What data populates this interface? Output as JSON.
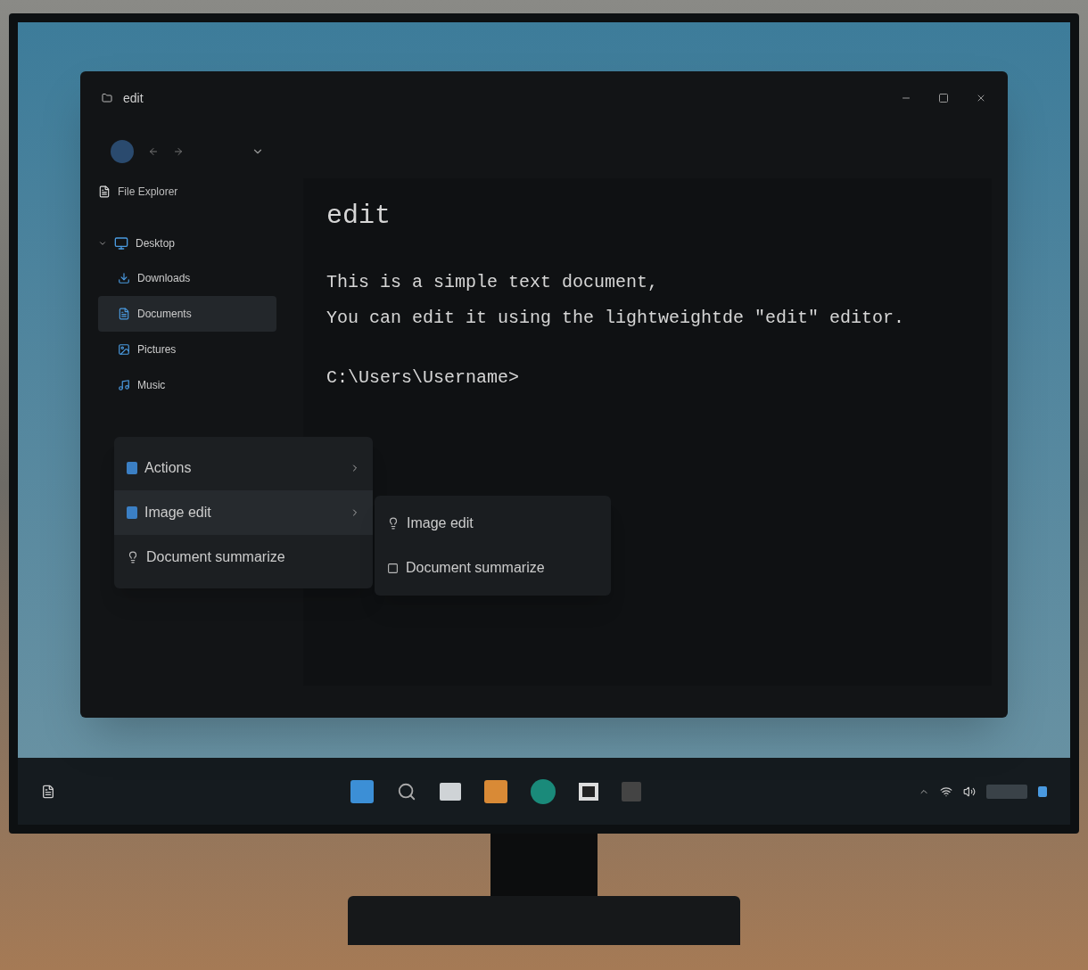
{
  "window": {
    "title": "edit"
  },
  "sidebar": {
    "header": "File Explorer",
    "items": [
      {
        "label": "Desktop",
        "expanded": true,
        "selected": false,
        "children": [
          {
            "label": "Downloads",
            "selected": false
          },
          {
            "label": "Documents",
            "selected": true
          },
          {
            "label": "Pictures",
            "selected": false
          },
          {
            "label": "Music",
            "selected": false
          }
        ]
      }
    ]
  },
  "document": {
    "heading": "edit",
    "lines": [
      "This is a simple text document,",
      "You can edit it using the lightweightde \"edit\" editor."
    ],
    "prompt": "C:\\Users\\Username>"
  },
  "context_menu": {
    "items": [
      {
        "label": "Actions",
        "kind": "submenu",
        "selected": false
      },
      {
        "label": "Image edit",
        "kind": "submenu",
        "selected": true
      },
      {
        "label": "Document summarize",
        "kind": "command",
        "selected": false
      }
    ],
    "submenu": {
      "items": [
        {
          "label": "Image edit",
          "kind": "bulb"
        },
        {
          "label": "Document summarize",
          "kind": "doc"
        }
      ]
    }
  }
}
